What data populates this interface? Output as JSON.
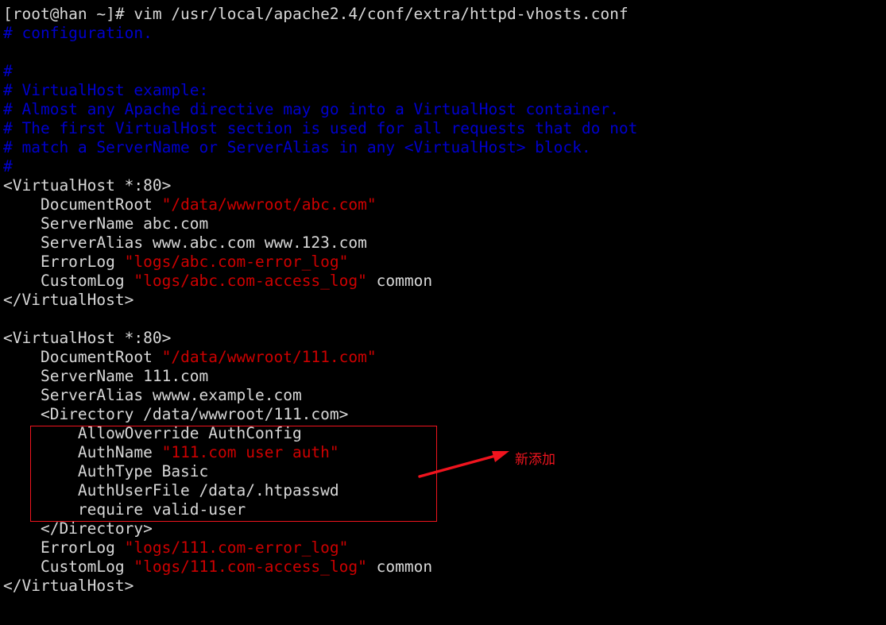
{
  "terminal": {
    "window_title": "root@han terminal",
    "background_color": "#000000",
    "foreground_color": "#d8d8d8",
    "comment_color": "#0000cd",
    "string_color": "#cd0000",
    "annotation_color": "#f0141e",
    "prompt_line": "[root@han ~]# vim /usr/local/apache2.4/conf/extra/httpd-vhosts.conf",
    "command": "vim /usr/local/apache2.4/conf/extra/httpd-vhosts.conf",
    "file_path": "/usr/local/apache2.4/conf/extra/httpd-vhosts.conf",
    "user": "root",
    "host": "han",
    "cwd": "~"
  },
  "file_lines": [
    {
      "id": "l01",
      "indent": 0,
      "segments": [
        {
          "text": "# configuration.",
          "color": "blue"
        }
      ]
    },
    {
      "id": "l02",
      "indent": 0,
      "segments": [
        {
          "text": "",
          "color": "blank"
        }
      ]
    },
    {
      "id": "l03",
      "indent": 0,
      "segments": [
        {
          "text": "#",
          "color": "blue"
        }
      ]
    },
    {
      "id": "l04",
      "indent": 0,
      "segments": [
        {
          "text": "# VirtualHost example:",
          "color": "blue"
        }
      ]
    },
    {
      "id": "l05",
      "indent": 0,
      "segments": [
        {
          "text": "# Almost any Apache directive may go into a VirtualHost container.",
          "color": "blue"
        }
      ]
    },
    {
      "id": "l06",
      "indent": 0,
      "segments": [
        {
          "text": "# The first VirtualHost section is used for all requests that do not",
          "color": "blue"
        }
      ]
    },
    {
      "id": "l07",
      "indent": 0,
      "segments": [
        {
          "text": "# match a ServerName or ServerAlias in any <VirtualHost> block.",
          "color": "blue"
        }
      ]
    },
    {
      "id": "l08",
      "indent": 0,
      "segments": [
        {
          "text": "#",
          "color": "blue"
        }
      ]
    },
    {
      "id": "l09",
      "indent": 0,
      "segments": [
        {
          "text": "<VirtualHost *:80>",
          "color": "white"
        }
      ]
    },
    {
      "id": "l10",
      "indent": 0,
      "segments": [
        {
          "text": "    DocumentRoot ",
          "color": "white"
        },
        {
          "text": "\"/data/wwwroot/abc.com\"",
          "color": "red"
        }
      ]
    },
    {
      "id": "l11",
      "indent": 0,
      "segments": [
        {
          "text": "    ServerName abc.com",
          "color": "white"
        }
      ]
    },
    {
      "id": "l12",
      "indent": 0,
      "segments": [
        {
          "text": "    ServerAlias www.abc.com www.123.com",
          "color": "white"
        }
      ]
    },
    {
      "id": "l13",
      "indent": 0,
      "segments": [
        {
          "text": "    ErrorLog ",
          "color": "white"
        },
        {
          "text": "\"logs/abc.com-error_log\"",
          "color": "red"
        }
      ]
    },
    {
      "id": "l14",
      "indent": 0,
      "segments": [
        {
          "text": "    CustomLog ",
          "color": "white"
        },
        {
          "text": "\"logs/abc.com-access_log\"",
          "color": "red"
        },
        {
          "text": " common",
          "color": "white"
        }
      ]
    },
    {
      "id": "l15",
      "indent": 0,
      "segments": [
        {
          "text": "</VirtualHost>",
          "color": "white"
        }
      ]
    },
    {
      "id": "l16",
      "indent": 0,
      "segments": [
        {
          "text": "",
          "color": "blank"
        }
      ]
    },
    {
      "id": "l17",
      "indent": 0,
      "segments": [
        {
          "text": "<VirtualHost *:80>",
          "color": "white"
        }
      ]
    },
    {
      "id": "l18",
      "indent": 0,
      "segments": [
        {
          "text": "    DocumentRoot ",
          "color": "white"
        },
        {
          "text": "\"/data/wwwroot/111.com\"",
          "color": "red"
        }
      ]
    },
    {
      "id": "l19",
      "indent": 0,
      "segments": [
        {
          "text": "    ServerName 111.com",
          "color": "white"
        }
      ]
    },
    {
      "id": "l20",
      "indent": 0,
      "segments": [
        {
          "text": "    ServerAlias wwww.example.com",
          "color": "white"
        }
      ]
    },
    {
      "id": "l21",
      "indent": 0,
      "segments": [
        {
          "text": "    <Directory /data/wwwroot/111.com>",
          "color": "white"
        }
      ]
    },
    {
      "id": "l22",
      "indent": 0,
      "segments": [
        {
          "text": "        AllowOverride AuthConfig",
          "color": "white"
        }
      ]
    },
    {
      "id": "l23",
      "indent": 0,
      "segments": [
        {
          "text": "        AuthName ",
          "color": "white"
        },
        {
          "text": "\"111.com user auth\"",
          "color": "red"
        }
      ]
    },
    {
      "id": "l24",
      "indent": 0,
      "segments": [
        {
          "text": "        AuthType Basic",
          "color": "white"
        }
      ]
    },
    {
      "id": "l25",
      "indent": 0,
      "segments": [
        {
          "text": "        AuthUserFile /data/.htpasswd",
          "color": "white"
        }
      ]
    },
    {
      "id": "l26",
      "indent": 0,
      "segments": [
        {
          "text": "        require valid-user",
          "color": "white"
        }
      ]
    },
    {
      "id": "l27",
      "indent": 0,
      "segments": [
        {
          "text": "    </Directory>",
          "color": "white"
        }
      ]
    },
    {
      "id": "l28",
      "indent": 0,
      "segments": [
        {
          "text": "    ErrorLog ",
          "color": "white"
        },
        {
          "text": "\"logs/111.com-error_log\"",
          "color": "red"
        }
      ]
    },
    {
      "id": "l29",
      "indent": 0,
      "segments": [
        {
          "text": "    CustomLog ",
          "color": "white"
        },
        {
          "text": "\"logs/111.com-access_log\"",
          "color": "red"
        },
        {
          "text": " common",
          "color": "white"
        }
      ]
    },
    {
      "id": "l30",
      "indent": 0,
      "segments": [
        {
          "text": "</VirtualHost>",
          "color": "white"
        }
      ]
    }
  ],
  "annotation": {
    "label": "新添加",
    "color": "#f0141e",
    "box_note": "red rectangle surrounding the newly added Directory auth block"
  }
}
